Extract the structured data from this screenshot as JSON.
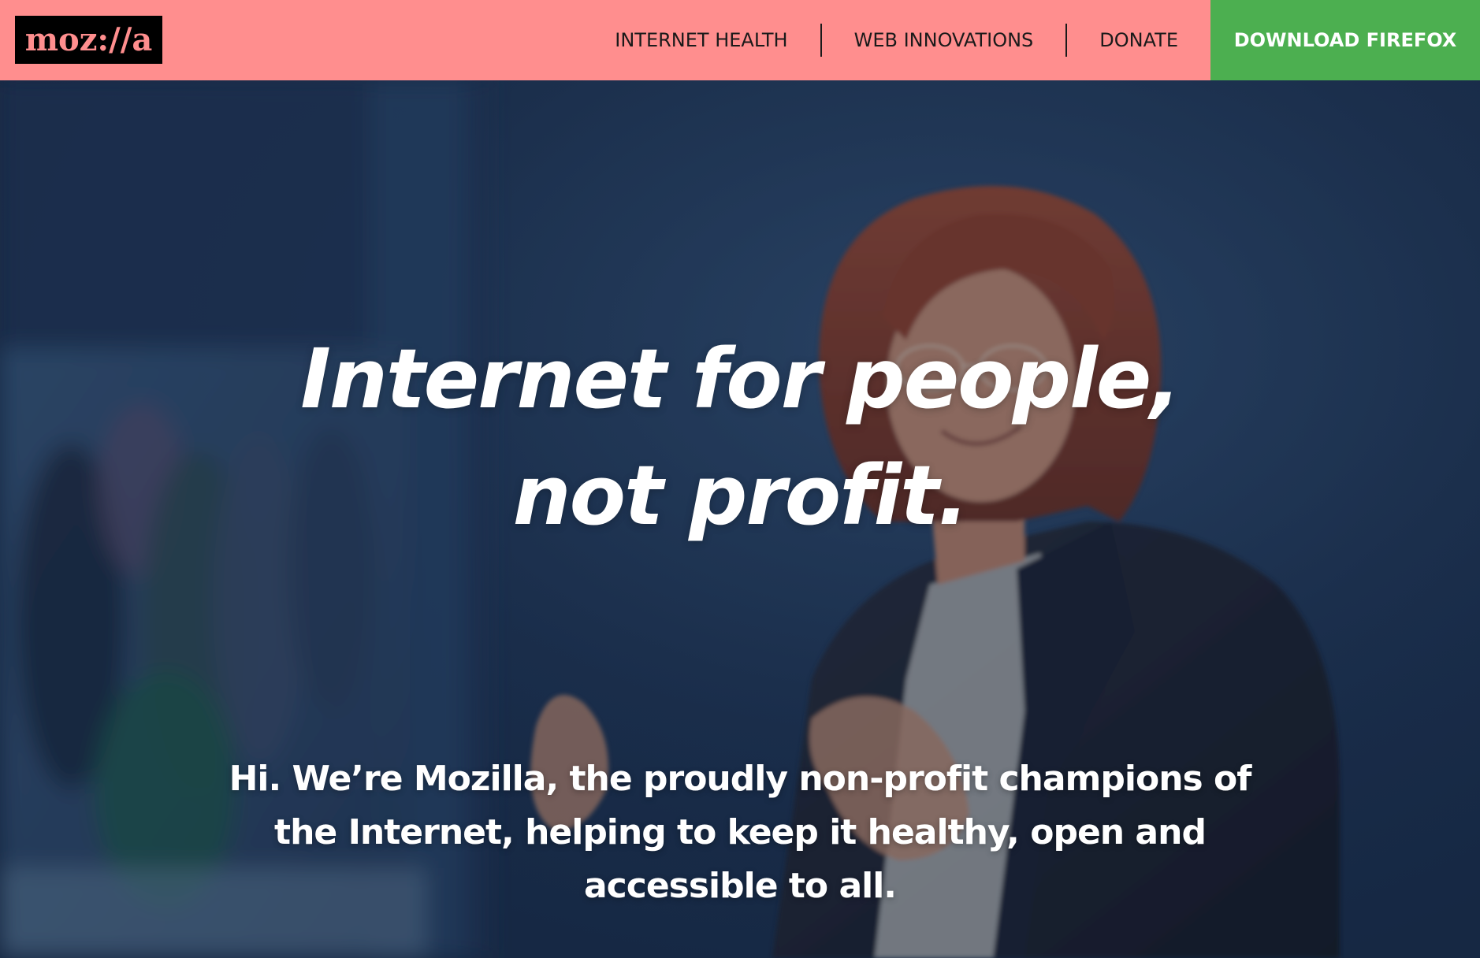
{
  "header": {
    "logo_text": "moz://a",
    "nav": [
      {
        "label": "INTERNET HEALTH"
      },
      {
        "label": "WEB INNOVATIONS"
      },
      {
        "label": "DONATE"
      }
    ],
    "cta_label": "DOWNLOAD FIREFOX"
  },
  "hero": {
    "headline_line1": "Internet for people,",
    "headline_line2": "not profit.",
    "intro": "Hi. We’re Mozilla, the proudly non-profit champions of the Internet, helping to keep it healthy, open and accessible to all."
  },
  "colors": {
    "header_bg": "#ff8e8e",
    "cta_bg": "#4caf50",
    "logo_bg": "#000000",
    "hero_bg": "#1f3553",
    "text_light": "#ffffff",
    "text_dark": "#1a1a1a"
  },
  "icons": {
    "logo": "mozilla-wordmark"
  }
}
